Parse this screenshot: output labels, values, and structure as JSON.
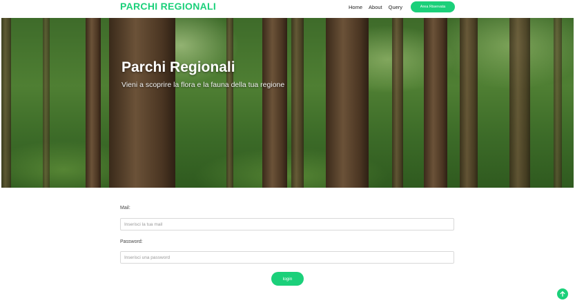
{
  "header": {
    "logo": "PARCHI REGIONALI",
    "nav": [
      "Home",
      "About",
      "Query"
    ],
    "area_button": "Area Riservata"
  },
  "hero": {
    "title": "Parchi Regionali",
    "subtitle": "Vieni a scoprire la flora e la fauna della tua regione"
  },
  "form": {
    "mail_label": "Mail:",
    "mail_placeholder": "Inserisci la tua mail",
    "password_label": "Password:",
    "password_placeholder": "Inserisci una password",
    "login_button": "login"
  },
  "scroll_top_icon": "arrow-up-icon",
  "colors": {
    "accent": "#1bd07a"
  }
}
